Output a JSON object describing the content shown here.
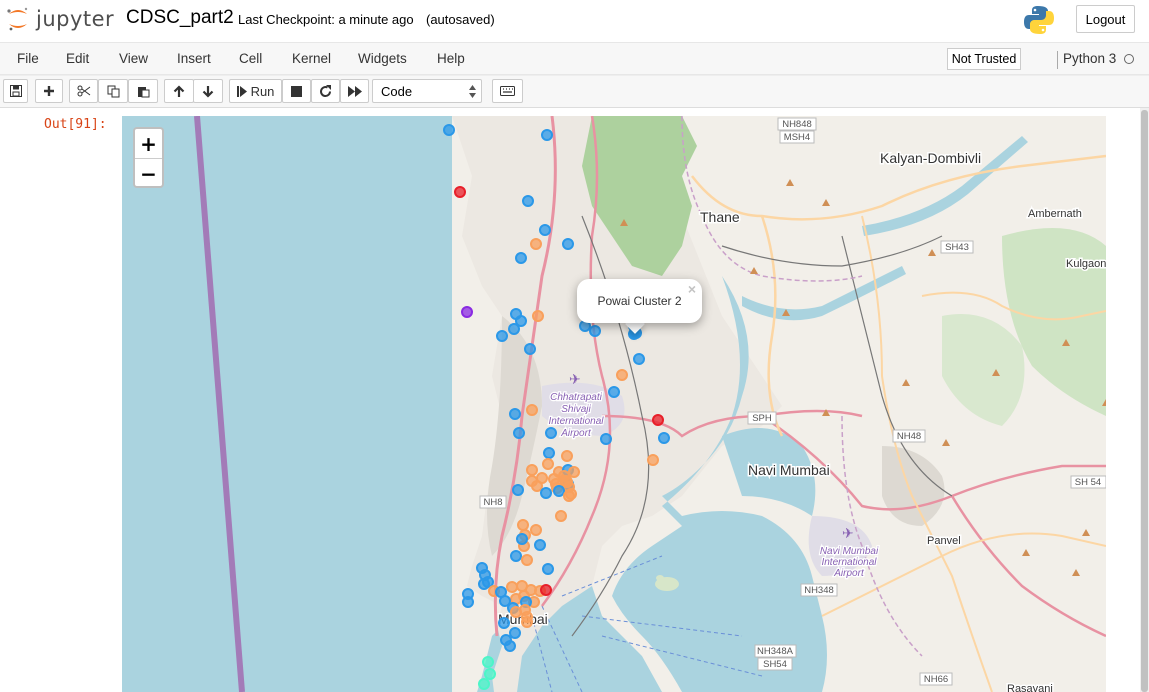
{
  "header": {
    "logo_text": "jupyter",
    "notebook_name": "CDSC_part2",
    "checkpoint": "Last Checkpoint: a minute ago",
    "autosave": "(autosaved)",
    "logout_label": "Logout"
  },
  "menu": {
    "items": [
      "File",
      "Edit",
      "View",
      "Insert",
      "Cell",
      "Kernel",
      "Widgets",
      "Help"
    ],
    "trust_label": "Not Trusted",
    "kernel_name": "Python 3"
  },
  "toolbar": {
    "run_label": "Run",
    "cell_type": "Code"
  },
  "output": {
    "prompt": "Out[91]:"
  },
  "map": {
    "zoom_in": "+",
    "zoom_out": "−",
    "popup_text": "Powai Cluster 2",
    "popup_close": "×",
    "place_labels": [
      "Kalyan-Dombivli",
      "Ambernath",
      "Thane",
      "Kulgaon",
      "Navi Mumbai",
      "Panvel",
      "Mumbai",
      "Rasayani",
      "Chhatrapati",
      "Shivaji",
      "International",
      "Airport",
      "Navi Mumbai",
      "International",
      "Airport"
    ],
    "road_labels": [
      "NH848",
      "MSH4",
      "SH43",
      "SPH",
      "NH48",
      "SH 54",
      "NH8",
      "NH348",
      "NH348A",
      "SH54",
      "NH66"
    ],
    "colors": {
      "water": "#aad3df",
      "land": "#f2efe9",
      "forest": "#add19e",
      "cluster_blue": "#2b98e8",
      "cluster_orange": "#f9a05c",
      "cluster_red": "#e8202a",
      "cluster_purple": "#8a2be2",
      "cluster_teal": "#4df5c8"
    }
  }
}
